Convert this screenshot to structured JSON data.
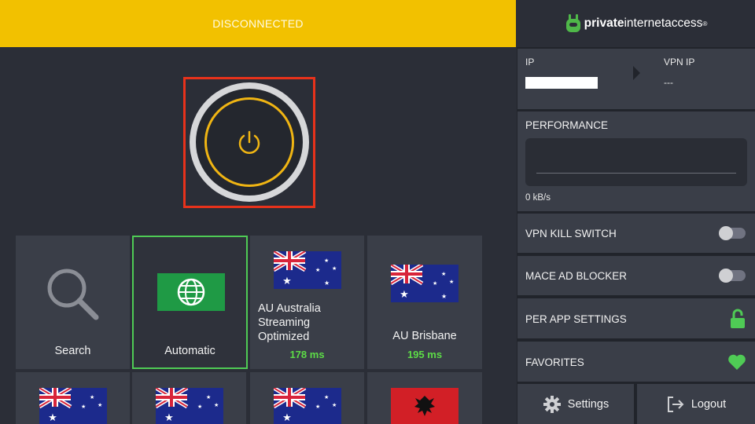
{
  "status": {
    "text": "DISCONNECTED",
    "color": "#f2c100"
  },
  "power": {
    "ring_color": "#f0b513",
    "icon": "power-icon"
  },
  "tiles": [
    {
      "label": "Search",
      "icon": "search-icon"
    },
    {
      "label": "Automatic",
      "icon": "globe-icon",
      "selected": true
    },
    {
      "label_lines": [
        "AU Australia",
        "Streaming",
        "Optimized"
      ],
      "ping": "178 ms",
      "flag": "australia-flag"
    },
    {
      "label": "AU Brisbane",
      "ping": "195 ms",
      "flag": "australia-flag"
    },
    {
      "flag": "australia-flag"
    },
    {
      "flag": "australia-flag"
    },
    {
      "flag": "australia-flag"
    },
    {
      "flag": "albania-flag"
    }
  ],
  "brand": {
    "bold": "private",
    "rest": "internetaccess",
    "reg": "®"
  },
  "ip": {
    "ip_label": "IP",
    "vpn_ip_label": "VPN IP",
    "vpn_ip_value": "---"
  },
  "performance": {
    "title": "PERFORMANCE",
    "rate": "0 kB/s"
  },
  "settings_rows": {
    "kill_switch": "VPN KILL SWITCH",
    "mace": "MACE AD BLOCKER",
    "per_app": "PER APP SETTINGS",
    "favorites": "FAVORITES"
  },
  "bottom": {
    "settings": "Settings",
    "logout": "Logout"
  },
  "colors": {
    "accent_green": "#4fcb55",
    "ping_green": "#5ddc47",
    "tile_bg": "#3a3e48"
  }
}
